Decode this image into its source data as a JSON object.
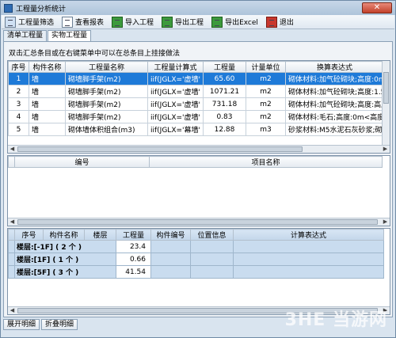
{
  "window": {
    "title": "工程量分析统计",
    "close_label": "✕"
  },
  "toolbar": {
    "items": [
      {
        "label": "工程量筛选",
        "icon": "filter-icon"
      },
      {
        "label": "查看报表",
        "icon": "report-icon"
      },
      {
        "label": "导入工程",
        "icon": "import-icon"
      },
      {
        "label": "导出工程",
        "icon": "export-icon"
      },
      {
        "label": "导出Excel",
        "icon": "excel-icon"
      },
      {
        "label": "退出",
        "icon": "exit-icon"
      }
    ]
  },
  "tabs": [
    {
      "label": "清单工程量"
    },
    {
      "label": "实物工程量",
      "active": true
    }
  ],
  "hint": "双击汇总条目或在右键菜单中可以在总条目上挂接做法",
  "top_grid": {
    "headers": [
      "序号",
      "构件名称",
      "工程量名称",
      "工程量计算式",
      "工程量",
      "计量单位",
      "换算表达式"
    ],
    "rows": [
      [
        "1",
        "墙",
        "砌墙脚手架(m2)",
        "iif(JGLX='虚墙' o",
        "65.60",
        "m2",
        "砌体材料:加气砼砌块;高度:0m<"
      ],
      [
        "2",
        "墙",
        "砌墙脚手架(m2)",
        "iif(JGLX='虚墙' o",
        "1071.21",
        "m2",
        "砌体材料:加气砼砌块;高度:1.5m"
      ],
      [
        "3",
        "墙",
        "砌墙脚手架(m2)",
        "iif(JGLX='虚墙' o",
        "731.18",
        "m2",
        "砌体材料:加气砼砌块;高度:高度>"
      ],
      [
        "4",
        "墙",
        "砌墙脚手架(m2)",
        "iif(JGLX='虚墙' o",
        "0.83",
        "m2",
        "砌体材料:毛石;高度:0m<高度<="
      ],
      [
        "5",
        "墙",
        "砌体墙体积组合(m3)",
        "iif(JGLX='幕墙' o",
        "12.88",
        "m3",
        "砂浆材料:M5水泥石灰砂浆;砌体材"
      ]
    ]
  },
  "mid_grid": {
    "headers": [
      "编号",
      "项目名称"
    ]
  },
  "bottom_grid": {
    "headers": [
      "序号",
      "构件名称",
      "楼层",
      "工程量",
      "构件编号",
      "位置信息",
      "计算表达式"
    ],
    "rows": [
      {
        "group": "楼层:[-1F] ( 2 个 )",
        "qty": "23.4"
      },
      {
        "group": "楼层:[1F] ( 1 个 )",
        "qty": "0.66"
      },
      {
        "group": "楼层:[5F] ( 3 个 )",
        "qty": "41.54"
      }
    ]
  },
  "bottom_buttons": {
    "expand": "展开明细",
    "collapse": "折叠明细"
  },
  "watermark": "3HE 当游网"
}
